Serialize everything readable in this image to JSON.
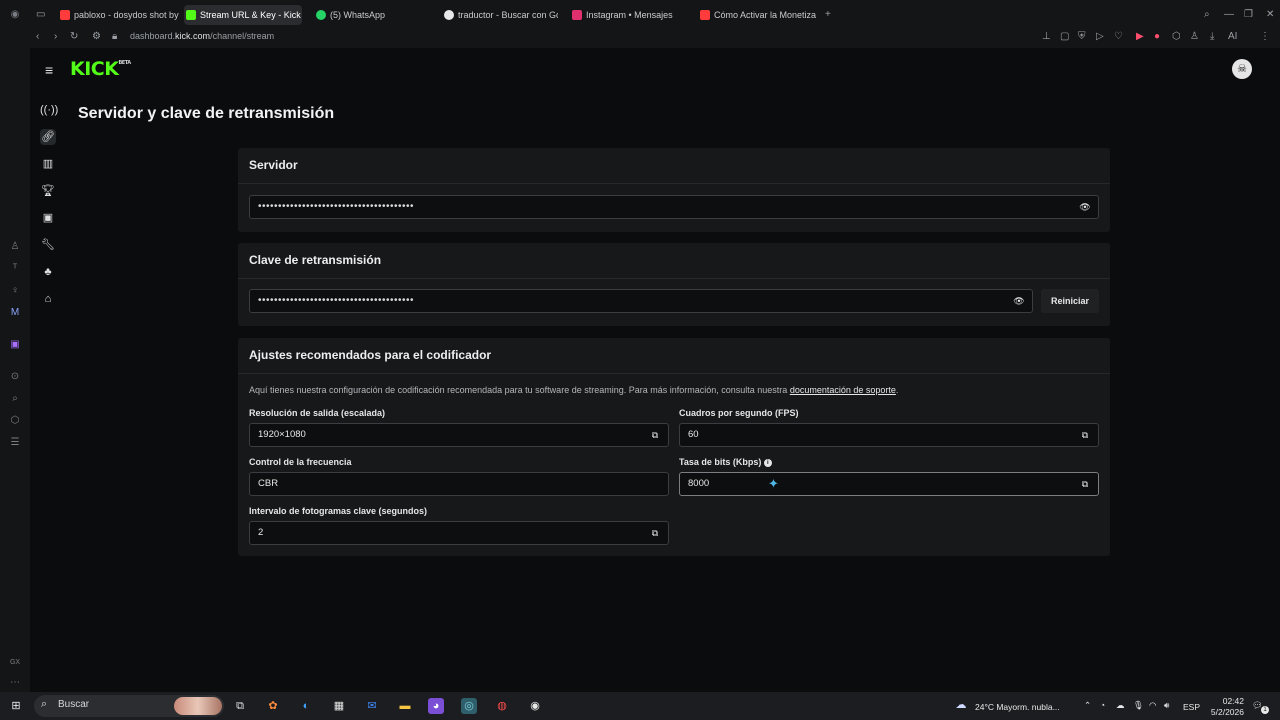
{
  "browser": {
    "tabs": [
      {
        "label": "pabloxo - dosydos shot by",
        "color": "#ff3b3b"
      },
      {
        "label": "Stream URL & Key - Kick D",
        "color": "#53fc18",
        "active": true
      },
      {
        "label": "(5) WhatsApp",
        "color": "#25d366"
      },
      {
        "label": "traductor - Buscar con Go",
        "color": "#e8e8e8"
      },
      {
        "label": "Instagram • Mensajes",
        "color": "#e1306c"
      },
      {
        "label": "Cómo Activar la Monetiza",
        "color": "#ff3b3b"
      }
    ],
    "new_tab": "+",
    "url_prefix": "dashboard.",
    "url_domain": "kick.com",
    "url_path": "/channel/stream"
  },
  "app": {
    "logo": "KICK",
    "logo_badge": "BETA",
    "page_title": "Servidor y clave de retransmisión"
  },
  "server": {
    "title": "Servidor",
    "masked_value": "•••••••••••••••••••••••••••••••••••••••"
  },
  "stream_key": {
    "title": "Clave de retransmisión",
    "masked_value": "•••••••••••••••••••••••••••••••••••••••",
    "reset_label": "Reiniciar"
  },
  "encoder": {
    "title": "Ajustes recomendados para el codificador",
    "description": "Aquí tienes nuestra configuración de codificación recomendada para tu software de streaming. Para más información, consulta nuestra ",
    "description_link": "documentación de soporte",
    "description_end": ".",
    "fields": {
      "resolution": {
        "label": "Resolución de salida (escalada)",
        "value": "1920×1080"
      },
      "fps": {
        "label": "Cuadros por segundo (FPS)",
        "value": "60"
      },
      "rate_control": {
        "label": "Control de la frecuencia",
        "value": "CBR"
      },
      "bitrate": {
        "label": "Tasa de bits (Kbps)",
        "value": "8000"
      },
      "keyframe": {
        "label": "Intervalo de fotogramas clave (segundos)",
        "value": "2"
      }
    }
  },
  "taskbar": {
    "search_placeholder": "Buscar",
    "weather": "24°C  Mayorm. nubla...",
    "language": "ESP",
    "time": "02:42",
    "date": "5/2/2026",
    "notification_count": "1"
  },
  "colors": {
    "kick_green": "#53fc18",
    "background": "#0b0c0d",
    "card": "#17181a"
  }
}
